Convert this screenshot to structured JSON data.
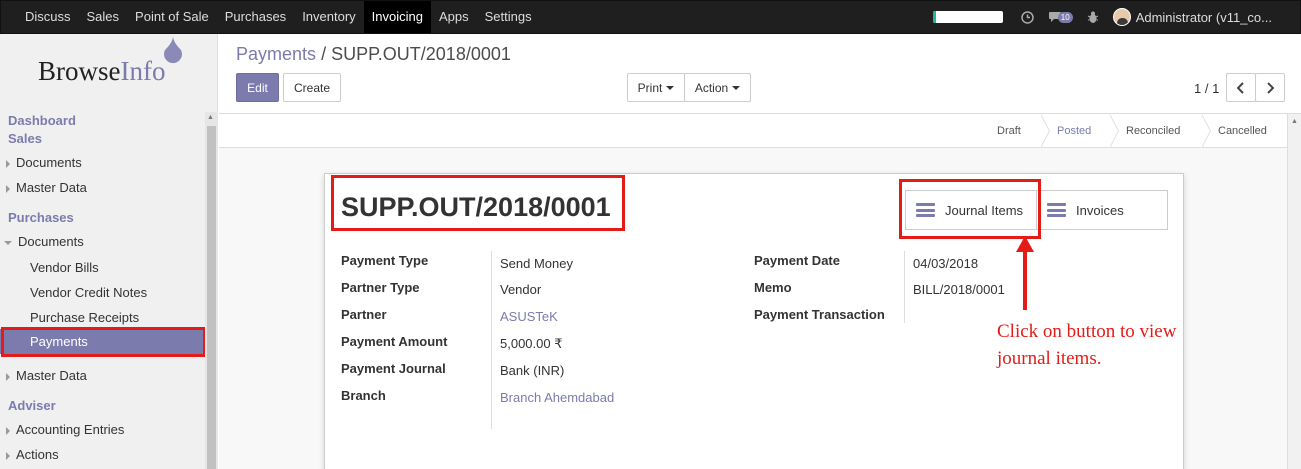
{
  "topnav": {
    "menu": [
      "Discuss",
      "Sales",
      "Point of Sale",
      "Purchases",
      "Inventory",
      "Invoicing",
      "Apps",
      "Settings"
    ],
    "active": "Invoicing",
    "progress_fraction": 0.05,
    "messages_count": "10",
    "user": "Administrator (v11_co..."
  },
  "sidebar": {
    "logo_browse": "Browse",
    "logo_info": "Info",
    "dashboard": "Dashboard",
    "sales": "Sales",
    "sales_documents": "Documents",
    "sales_master_data": "Master Data",
    "purchases": "Purchases",
    "purchases_documents": "Documents",
    "vendor_bills": "Vendor Bills",
    "vendor_credit_notes": "Vendor Credit Notes",
    "purchase_receipts": "Purchase Receipts",
    "payments": "Payments",
    "purchases_master_data": "Master Data",
    "adviser": "Adviser",
    "accounting_entries": "Accounting Entries",
    "actions": "Actions"
  },
  "control": {
    "breadcrumb_parent": "Payments",
    "breadcrumb_sep": "/",
    "breadcrumb_current": "SUPP.OUT/2018/0001",
    "edit": "Edit",
    "create": "Create",
    "print": "Print",
    "action": "Action",
    "pager": "1 / 1"
  },
  "status": {
    "stages": [
      "Draft",
      "Posted",
      "Reconciled",
      "Cancelled"
    ],
    "current": "Posted"
  },
  "form": {
    "title": "SUPP.OUT/2018/0001",
    "journal_items": "Journal Items",
    "invoices": "Invoices",
    "left_fields": [
      {
        "label": "Payment Type",
        "value": "Send Money"
      },
      {
        "label": "Partner Type",
        "value": "Vendor"
      },
      {
        "label": "Partner",
        "value": "ASUSTeK"
      },
      {
        "label": "Payment Amount",
        "value": "5,000.00 ₹"
      },
      {
        "label": "Payment Journal",
        "value": "Bank (INR)"
      },
      {
        "label": "Branch",
        "value": "Branch Ahemdabad"
      }
    ],
    "right_fields": [
      {
        "label": "Payment Date",
        "value": "04/03/2018"
      },
      {
        "label": "Memo",
        "value": "BILL/2018/0001"
      },
      {
        "label": "Payment Transaction",
        "value": ""
      }
    ]
  },
  "annotation": {
    "line1": "Click on button to view",
    "line2": "journal items."
  },
  "colors": {
    "accent": "#7c7bad",
    "highlight_red": "#e41b17",
    "topbar": "#1f1f1f"
  }
}
